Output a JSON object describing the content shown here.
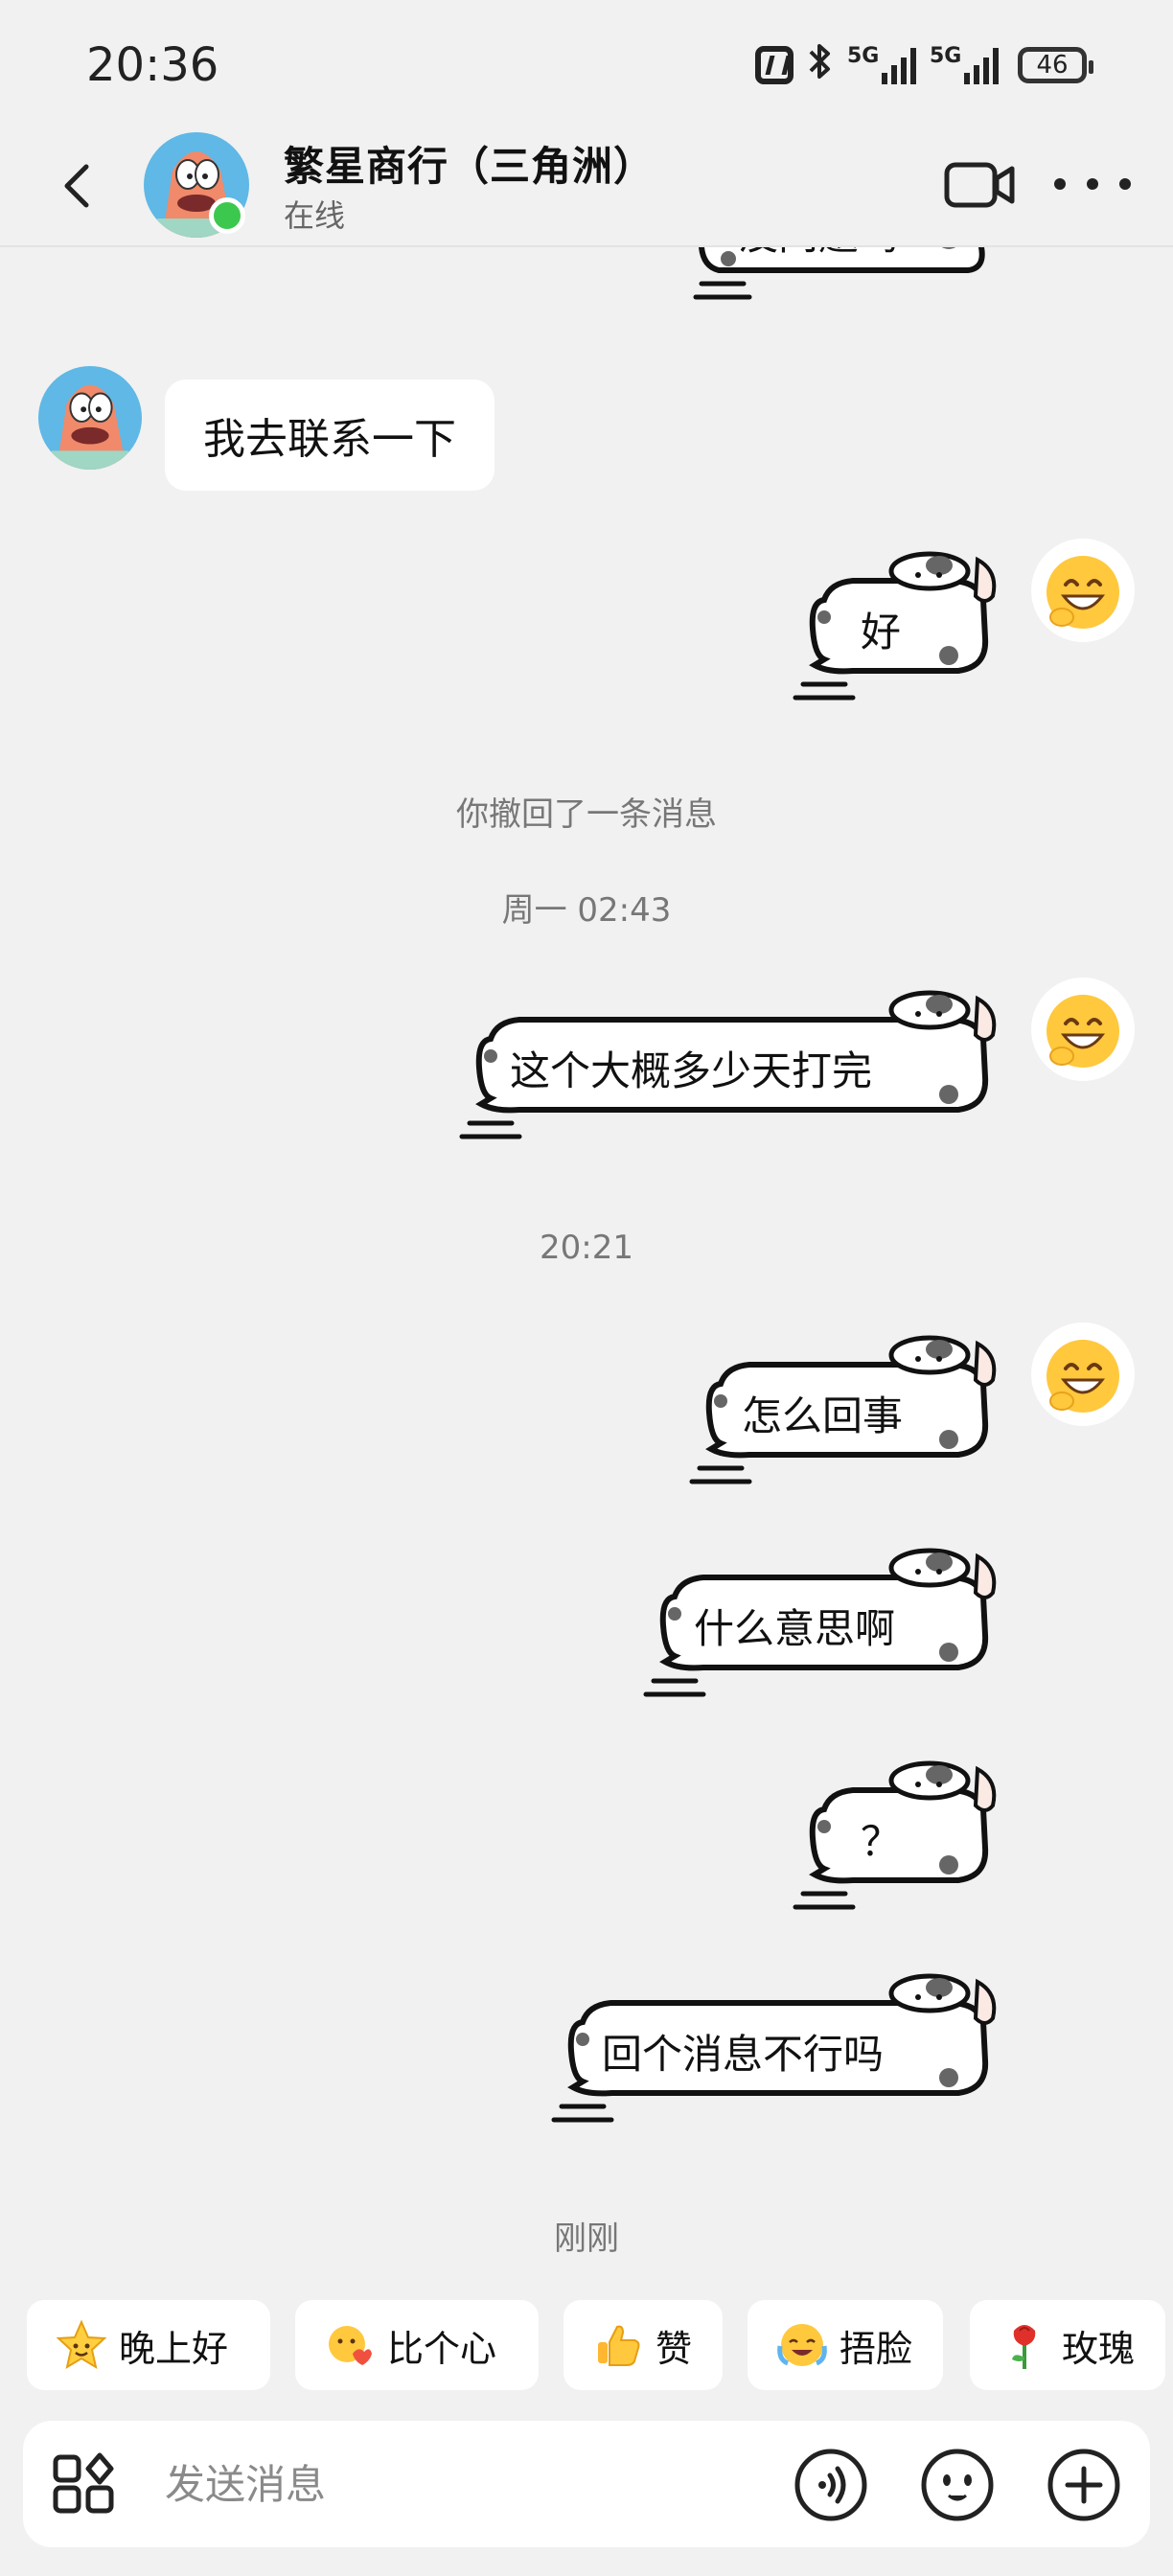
{
  "status_bar": {
    "time": "20:36",
    "network_1": "5G",
    "network_2": "5G",
    "battery": "46",
    "icons": [
      "nfc-icon",
      "bluetooth-icon",
      "signal-5g-icon",
      "signal-5g-icon",
      "battery-icon"
    ]
  },
  "header": {
    "title": "繁星商行（三角洲）",
    "status": "在线"
  },
  "chat": {
    "partial_message": "没问题吗",
    "incoming_message": "我去联系一下",
    "outgoing_1": "好",
    "recall_notice": "你撤回了一条消息",
    "time_1": "周一 02:43",
    "outgoing_2": "这个大概多少天打完",
    "time_2": "20:21",
    "outgoing_3": "怎么回事",
    "outgoing_4": "什么意思啊",
    "outgoing_5": "？",
    "outgoing_6": "回个消息不行吗",
    "time_3": "刚刚"
  },
  "quick_replies": [
    {
      "label": "晚上好",
      "icon": "star-face-icon"
    },
    {
      "label": "比个心",
      "icon": "heart-hand-icon"
    },
    {
      "label": "赞",
      "icon": "thumbs-up-icon"
    },
    {
      "label": "捂脸",
      "icon": "facepalm-icon"
    },
    {
      "label": "玫瑰",
      "icon": "rose-icon"
    }
  ],
  "input": {
    "placeholder": "发送消息",
    "value": ""
  }
}
